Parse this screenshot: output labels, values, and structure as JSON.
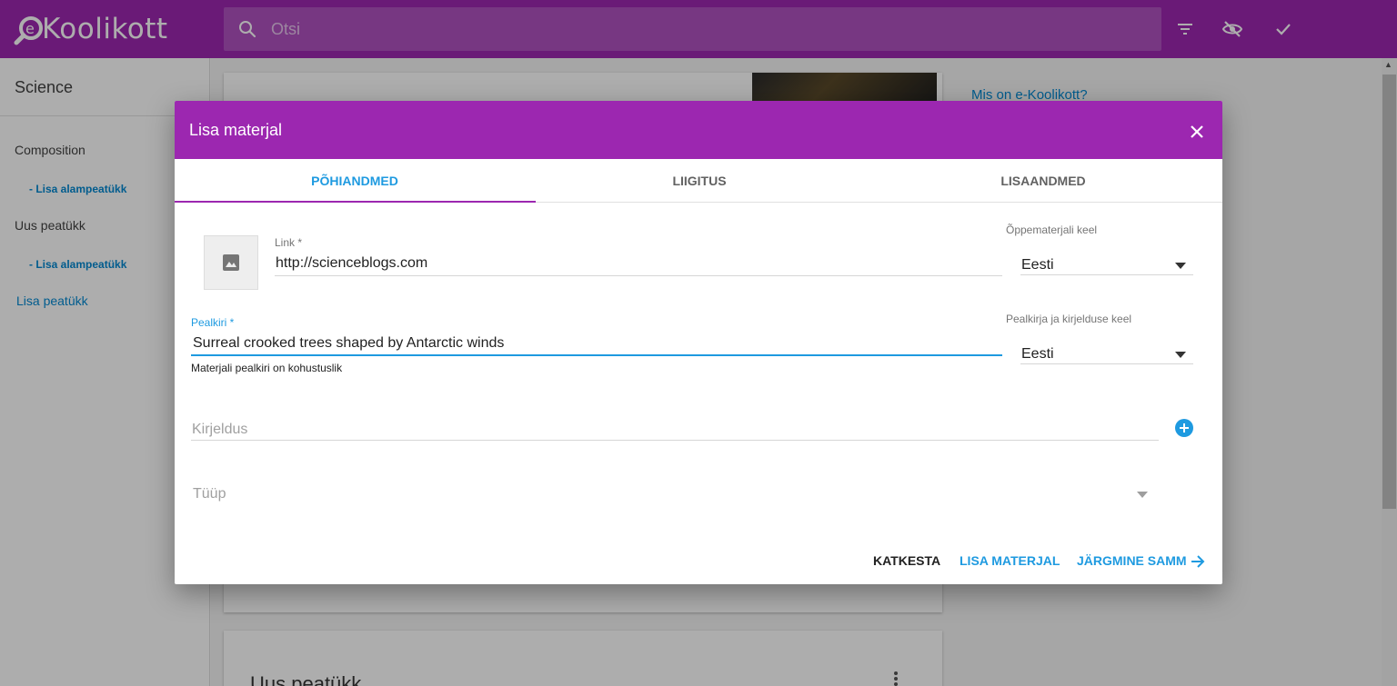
{
  "app": {
    "logo_text": "Koolikott",
    "search_placeholder": "Otsi"
  },
  "sidebar": {
    "title": "Science",
    "items": [
      {
        "label": "Composition",
        "sub": "- Lisa alampeatükk"
      },
      {
        "label": "Uus peatükk",
        "sub": "- Lisa alampeatükk"
      }
    ],
    "add_chapter": "Lisa peatükk"
  },
  "background": {
    "info_link": "Mis on e-Koolikott?",
    "card2_title": "Uus peatükk"
  },
  "dialog": {
    "title": "Lisa materjal",
    "tabs": [
      {
        "label": "PÕHIANDMED",
        "active": true
      },
      {
        "label": "LIIGITUS",
        "active": false
      },
      {
        "label": "LISAANDMED",
        "active": false
      }
    ],
    "link": {
      "label": "Link *",
      "value": "http://scienceblogs.com"
    },
    "material_language": {
      "label": "Õppematerjali keel",
      "value": "Eesti"
    },
    "title_field": {
      "label": "Pealkiri *",
      "value": "Surreal crooked trees shaped by Antarctic winds",
      "hint": "Materjali pealkiri on kohustuslik"
    },
    "title_language": {
      "label": "Pealkirja ja kirjelduse keel",
      "value": "Eesti"
    },
    "description": {
      "placeholder": "Kirjeldus"
    },
    "type": {
      "placeholder": "Tüüp"
    },
    "actions": {
      "cancel": "KATKESTA",
      "add": "LISA MATERJAL",
      "next": "JÄRGMINE SAMM"
    }
  },
  "colors": {
    "brand": "#9c27b0",
    "accent": "#1e9ae0",
    "link": "#0288d1"
  }
}
